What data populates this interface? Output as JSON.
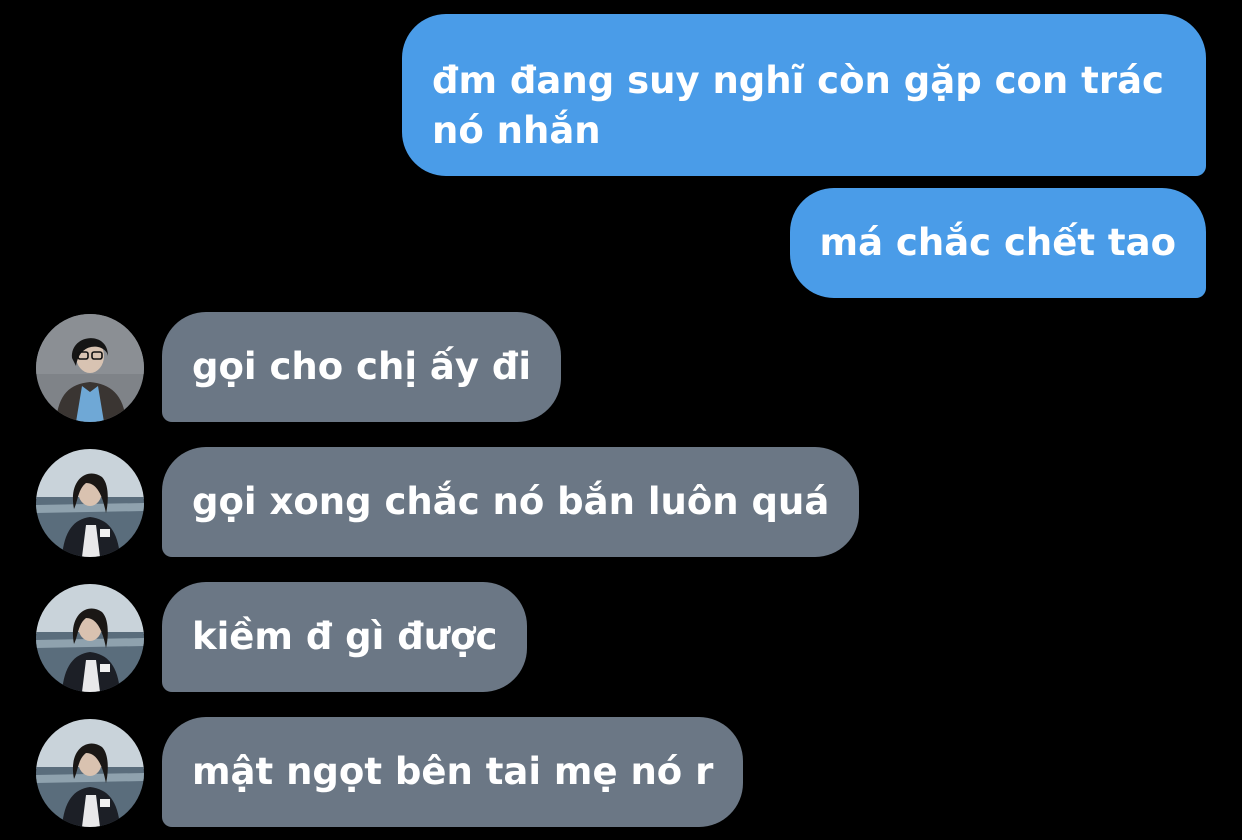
{
  "colors": {
    "background": "#000000",
    "sent_bubble": "#4a9ce8",
    "received_bubble": "#6b7785",
    "text": "#ffffff"
  },
  "messages": [
    {
      "direction": "sent",
      "lines": [
        "đm đang suy nghĩ còn gặp con trác",
        "nó nhắn"
      ]
    },
    {
      "direction": "sent",
      "text": "má chắc chết tao"
    },
    {
      "direction": "received",
      "text": "gọi cho chị ấy đi",
      "avatar_icon": "contact-avatar-blue-shirt-icon"
    },
    {
      "direction": "received",
      "text": "gọi xong chắc nó bắn luôn quá",
      "avatar_icon": "contact-avatar-sea-icon"
    },
    {
      "direction": "received",
      "text": "kiềm đ gì được",
      "avatar_icon": "contact-avatar-sea-icon"
    },
    {
      "direction": "received",
      "text": "mật ngọt bên tai mẹ nó r",
      "avatar_icon": "contact-avatar-sea-icon"
    }
  ]
}
